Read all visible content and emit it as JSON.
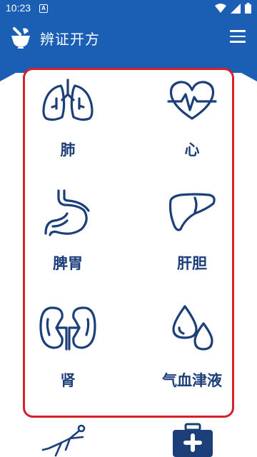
{
  "status_bar": {
    "time": "10:23",
    "notification_glyph": "A",
    "icons": [
      "wifi-icon",
      "signal-icon",
      "battery-icon"
    ]
  },
  "app_bar": {
    "title": "辨证开方",
    "menu_icon": "hamburger-menu-icon",
    "logo_icon": "mortar-logo-icon"
  },
  "colors": {
    "primary": "#1a5fb4",
    "organ_icon": "#1c3f7a",
    "highlight_border": "#d6202a"
  },
  "grid": {
    "items": [
      {
        "label": "肺",
        "icon": "lungs-icon"
      },
      {
        "label": "心",
        "icon": "heart-pulse-icon"
      },
      {
        "label": "脾胃",
        "icon": "stomach-icon"
      },
      {
        "label": "肝胆",
        "icon": "liver-icon"
      },
      {
        "label": "肾",
        "icon": "kidneys-icon"
      },
      {
        "label": "气血津液",
        "icon": "drops-icon"
      }
    ]
  },
  "bottom_row": {
    "icons": [
      "human-body-icon",
      "first-aid-kit-icon"
    ]
  }
}
